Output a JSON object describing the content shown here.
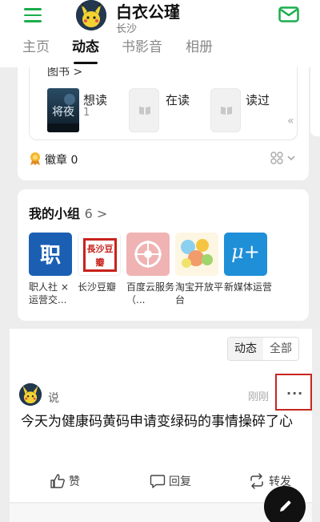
{
  "header": {
    "user_name": "白衣公瑾",
    "city": "长沙",
    "tabs": [
      {
        "label": "主页"
      },
      {
        "label": "动态"
      },
      {
        "label": "书影音"
      },
      {
        "label": "相册"
      }
    ]
  },
  "books": {
    "section_title": "图书 >",
    "book_title_art": "将夜",
    "shelves": [
      {
        "label": "想读",
        "count": "1"
      },
      {
        "label": "在读"
      },
      {
        "label": "读过"
      }
    ],
    "collapse_glyph": "«",
    "medal_text": "徽章 0"
  },
  "groups": {
    "title": "我的小组",
    "count": "6 >",
    "items": [
      {
        "name": "职人社 × 运营交...",
        "icon_text": "职",
        "color": "#1b5fb3"
      },
      {
        "name": "长沙豆瓣",
        "icon_text": "長沙豆瓣",
        "color": "#c8221c"
      },
      {
        "name": "百度云服务（...",
        "icon_text": "",
        "color": "#e89a9a"
      },
      {
        "name": "淘宝开放平台",
        "icon_text": "",
        "color": "#f5c542"
      },
      {
        "name": "新媒体运营",
        "icon_text": "μ+",
        "color": "#1f8fd8"
      }
    ]
  },
  "feed": {
    "filters": [
      {
        "label": "动态"
      },
      {
        "label": "全部"
      }
    ],
    "post": {
      "action": "说",
      "time": "刚刚",
      "more": "···",
      "text": "今天为健康码黄码申请变绿码的事情操碎了心",
      "actions": [
        {
          "label": "赞"
        },
        {
          "label": "回复"
        },
        {
          "label": "转发"
        }
      ]
    }
  },
  "colors": {
    "accent": "#1aad4b",
    "highlight_box": "#c8271f"
  }
}
